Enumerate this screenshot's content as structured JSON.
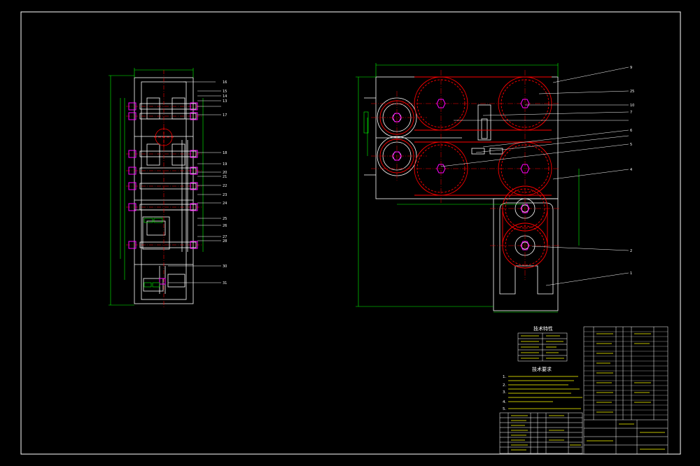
{
  "drawing": {
    "colors": {
      "background": "#000000",
      "frame": "#ffffff",
      "outline": "#ffffff",
      "dimension": "#00ff00",
      "centerline": "#ff0000",
      "gear": "#ff0000",
      "fastener": "#ff00ff",
      "leader": "#ffffff"
    },
    "side_view_callouts": [
      "16",
      "15",
      "14",
      "13",
      "17",
      "18",
      "19",
      "20",
      "21",
      "22",
      "23",
      "24",
      "25",
      "26",
      "27",
      "28",
      "30",
      "31"
    ],
    "main_view_callouts": [
      "9",
      "25",
      "10",
      "7",
      "6",
      "5",
      "3",
      "4",
      "2",
      "1"
    ],
    "tech_specs_title": "技术特性",
    "tech_requirements_title": "技术要求",
    "tech_requirements": [
      "1.",
      "2.",
      "3.",
      "4.",
      "5."
    ]
  }
}
